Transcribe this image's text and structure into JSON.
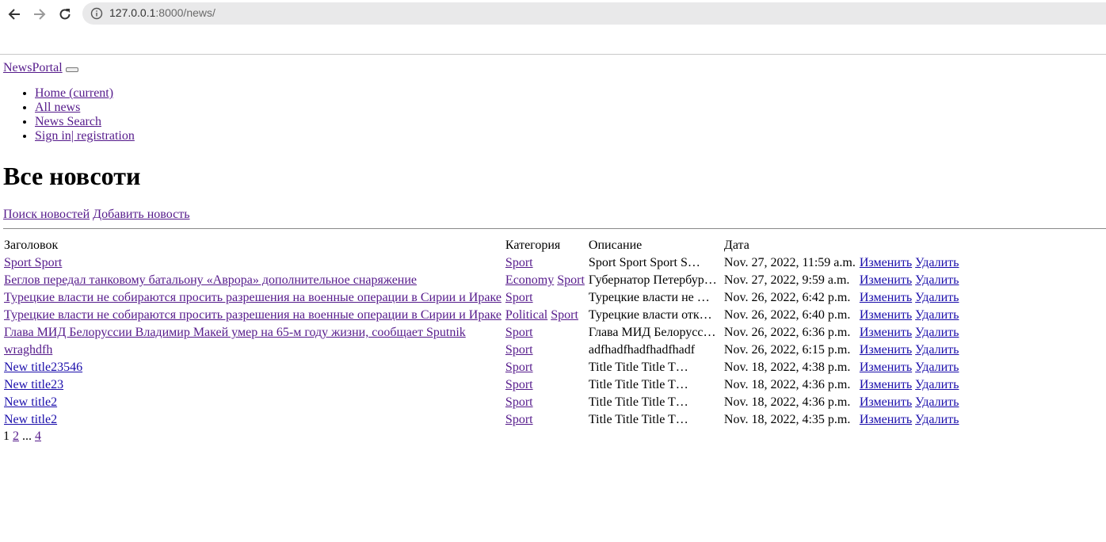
{
  "browser": {
    "url_host": "127.0.0.1",
    "url_rest": ":8000/news/"
  },
  "navbar": {
    "brand": "NewsPortal",
    "items": [
      {
        "label": "Home (current)"
      },
      {
        "label": "All news"
      },
      {
        "label": "News Search"
      },
      {
        "label": "Sign in| registration"
      }
    ]
  },
  "page": {
    "heading": "Все новсоти",
    "search_link": "Поиск новостей",
    "add_link": "Добавить новость"
  },
  "table": {
    "headers": {
      "title": "Заголовок",
      "category": "Категория",
      "description": "Описание",
      "date": "Дата"
    },
    "edit_label": "Изменить",
    "delete_label": "Удалить",
    "rows": [
      {
        "title": "Sport Sport",
        "categories": [
          "Sport"
        ],
        "description": "Sport Sport Sport S…",
        "date": "Nov. 27, 2022, 11:59 a.m."
      },
      {
        "title": "Беглов передал танковому батальону «Аврора» дополнительное снаряжение",
        "categories": [
          "Economy",
          "Sport"
        ],
        "description": "Губернатор Петербур…",
        "date": "Nov. 27, 2022, 9:59 a.m."
      },
      {
        "title": "Турецкие власти не собираются просить разрешения на военные операции в Сирии и Ираке",
        "categories": [
          "Sport"
        ],
        "description": "Турецкие власти не …",
        "date": "Nov. 26, 2022, 6:42 p.m."
      },
      {
        "title": "Турецкие власти не собираются просить разрешения на военные операции в Сирии и Ираке",
        "categories": [
          "Political",
          "Sport"
        ],
        "description": "Турецкие власти отк…",
        "date": "Nov. 26, 2022, 6:40 p.m."
      },
      {
        "title": "Глава МИД Белоруссии Владимир Макей умер на 65-м году жизни, сообщает Sputnik",
        "categories": [
          "Sport"
        ],
        "description": "Глава МИД Белорусси…",
        "date": "Nov. 26, 2022, 6:36 p.m."
      },
      {
        "title": "wraghdfh",
        "categories": [
          "Sport"
        ],
        "description": "adfhadfhadfhadfhadf",
        "date": "Nov. 26, 2022, 6:15 p.m."
      },
      {
        "title": "New title23546",
        "categories": [
          "Sport"
        ],
        "description": "Title Title Title T…",
        "date": "Nov. 18, 2022, 4:38 p.m."
      },
      {
        "title": "New title23",
        "categories": [
          "Sport"
        ],
        "description": "Title Title Title T…",
        "date": "Nov. 18, 2022, 4:36 p.m."
      },
      {
        "title": "New title2",
        "categories": [
          "Sport"
        ],
        "description": "Title Title Title T…",
        "date": "Nov. 18, 2022, 4:36 p.m."
      },
      {
        "title": "New title2",
        "categories": [
          "Sport"
        ],
        "description": "Title Title Title T…",
        "date": "Nov. 18, 2022, 4:35 p.m."
      }
    ]
  },
  "pagination": {
    "current": "1",
    "next": "2",
    "ellipsis": "...",
    "last": "4"
  }
}
